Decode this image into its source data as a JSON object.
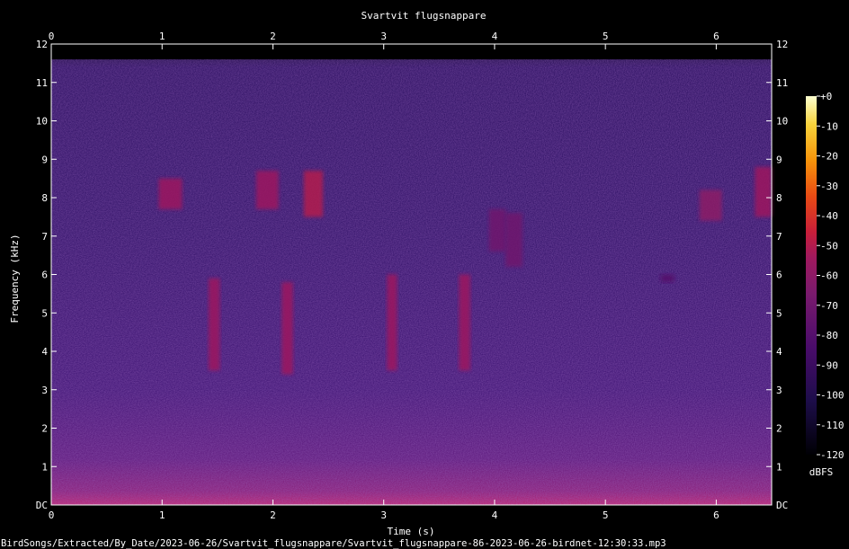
{
  "chart_data": {
    "type": "heatmap",
    "title": "Svartvit flugsnappare",
    "xlabel": "Time (s)",
    "ylabel": "Frequency (kHz)",
    "x_range": [
      0,
      6.5
    ],
    "y_range": [
      0,
      12
    ],
    "x_ticks": [
      "0",
      "1",
      "2",
      "3",
      "4",
      "5",
      "6"
    ],
    "y_ticks": [
      "DC",
      "1",
      "2",
      "3",
      "4",
      "5",
      "6",
      "7",
      "8",
      "9",
      "10",
      "11",
      "12"
    ],
    "colorbar": {
      "label": "dBFS",
      "range": [
        -120,
        0
      ],
      "ticks": [
        "+0",
        "-10",
        "-20",
        "-30",
        "-40",
        "-50",
        "-60",
        "-70",
        "-80",
        "-90",
        "-100",
        "-110",
        "-120"
      ]
    },
    "features": [
      {
        "t_start": 0.97,
        "t_end": 1.18,
        "f_low": 7.7,
        "f_high": 8.5,
        "level": -55
      },
      {
        "t_start": 1.85,
        "t_end": 2.05,
        "f_low": 7.7,
        "f_high": 8.7,
        "level": -55
      },
      {
        "t_start": 2.28,
        "t_end": 2.45,
        "f_low": 7.5,
        "f_high": 8.7,
        "level": -50
      },
      {
        "t_start": 1.42,
        "t_end": 1.52,
        "f_low": 3.5,
        "f_high": 5.9,
        "level": -55
      },
      {
        "t_start": 2.08,
        "t_end": 2.18,
        "f_low": 3.4,
        "f_high": 5.8,
        "level": -55
      },
      {
        "t_start": 3.03,
        "t_end": 3.12,
        "f_low": 3.5,
        "f_high": 6.0,
        "level": -55
      },
      {
        "t_start": 3.68,
        "t_end": 3.78,
        "f_low": 3.5,
        "f_high": 6.0,
        "level": -55
      },
      {
        "t_start": 3.95,
        "t_end": 4.1,
        "f_low": 6.6,
        "f_high": 7.7,
        "level": -70
      },
      {
        "t_start": 4.1,
        "t_end": 4.25,
        "f_low": 6.2,
        "f_high": 7.6,
        "level": -70
      },
      {
        "t_start": 5.5,
        "t_end": 5.62,
        "f_low": 5.8,
        "f_high": 6.0,
        "level": -80
      },
      {
        "t_start": 5.85,
        "t_end": 6.05,
        "f_low": 7.4,
        "f_high": 8.2,
        "level": -60
      },
      {
        "t_start": 6.35,
        "t_end": 6.5,
        "f_low": 7.5,
        "f_high": 8.8,
        "level": -55
      }
    ]
  },
  "footer": {
    "path": "BirdSongs/Extracted/By_Date/2023-06-26/Svartvit_flugsnappare/Svartvit_flugsnappare-86-2023-06-26-birdnet-12:30:33.mp3"
  }
}
